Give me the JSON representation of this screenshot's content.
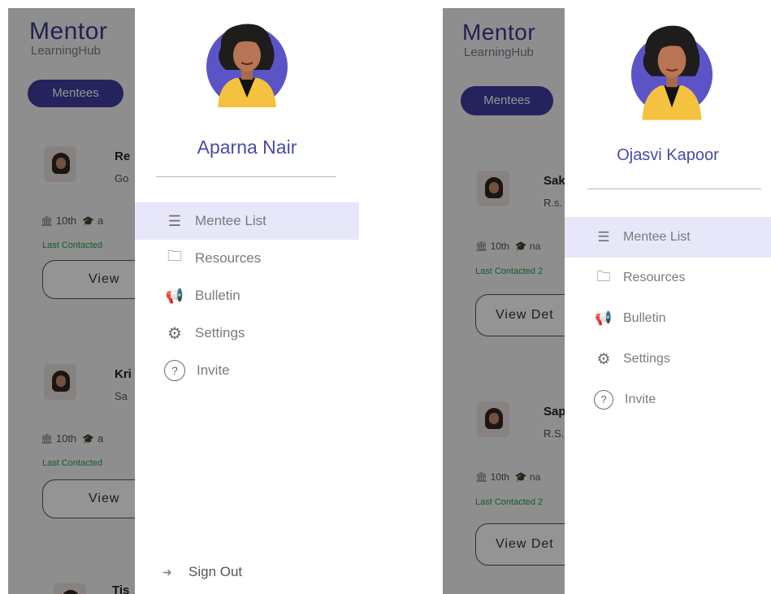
{
  "left": {
    "brand": {
      "title": "Mentor",
      "subtitle": "LearningHub"
    },
    "tab_active": "Mentees",
    "cards": [
      {
        "name": "Re",
        "school": "Go",
        "grade": "10th",
        "stream": "a",
        "last_contacted": "Last Contacted",
        "button": "View"
      },
      {
        "name": "Kri",
        "school": "Sa",
        "grade": "10th",
        "stream": "a",
        "last_contacted": "Last Contacted",
        "button": "View"
      },
      {
        "name": "Tis"
      }
    ],
    "drawer": {
      "user_name": "Aparna Nair",
      "menu": [
        {
          "icon": "list-icon",
          "glyph": "☰",
          "label": "Mentee List",
          "active": true
        },
        {
          "icon": "folder-icon",
          "glyph": "🗀",
          "label": "Resources",
          "active": false
        },
        {
          "icon": "megaphone-icon",
          "glyph": "📢",
          "label": "Bulletin",
          "active": false
        },
        {
          "icon": "gear-icon",
          "glyph": "⚙",
          "label": "Settings",
          "active": false
        },
        {
          "icon": "help-icon",
          "glyph": "?",
          "label": "Invite",
          "active": false
        }
      ],
      "sign_out": "Sign Out"
    }
  },
  "right": {
    "brand": {
      "title": "Mentor",
      "subtitle": "LearningHub"
    },
    "tab_active": "Mentees",
    "cards": [
      {
        "name": "Sak",
        "school": "R.s.",
        "grade": "10th",
        "stream": "na",
        "last_contacted": "Last Contacted 2",
        "button": "View Det"
      },
      {
        "name": "Sap",
        "school": "R.S.",
        "grade": "10th",
        "stream": "na",
        "last_contacted": "Last Contacted 2",
        "button": "View Det"
      }
    ],
    "drawer": {
      "user_name": "Ojasvi Kapoor",
      "menu": [
        {
          "icon": "list-icon",
          "glyph": "☰",
          "label": "Mentee List",
          "active": true
        },
        {
          "icon": "folder-icon",
          "glyph": "🗀",
          "label": "Resources",
          "active": false
        },
        {
          "icon": "megaphone-icon",
          "glyph": "📢",
          "label": "Bulletin",
          "active": false
        },
        {
          "icon": "gear-icon",
          "glyph": "⚙",
          "label": "Settings",
          "active": false
        },
        {
          "icon": "help-icon",
          "glyph": "?",
          "label": "Invite",
          "active": false
        }
      ]
    }
  },
  "colors": {
    "accent": "#3f3d9e",
    "name": "#4a4aa8",
    "active_row": "#e7e7f9",
    "last_contacted": "#2aa14a"
  }
}
